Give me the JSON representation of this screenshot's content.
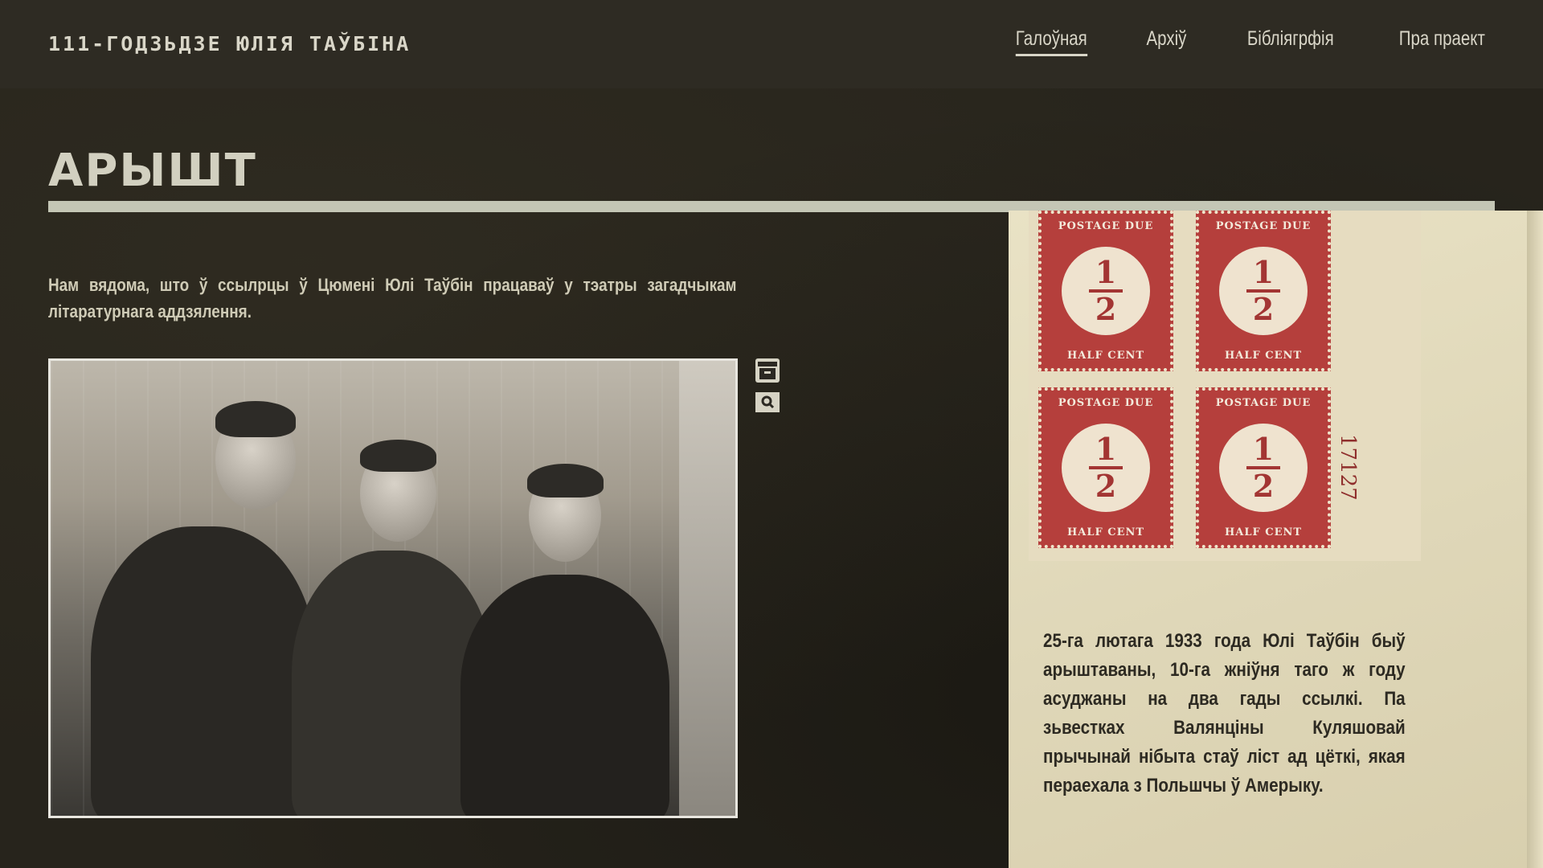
{
  "header": {
    "site_title": "111-ГОДЗЬДЗЕ ЮЛІЯ ТАЎБІНА",
    "nav": [
      {
        "label": "Галоўная",
        "active": true
      },
      {
        "label": "Архіў",
        "active": false
      },
      {
        "label": "Бібліягрфія",
        "active": false
      },
      {
        "label": "Пра праект",
        "active": false
      }
    ]
  },
  "main": {
    "page_title": "АРЫШТ",
    "intro_text": "Нам вядома, што ў ссылрцы ў Цюмені Юлі Таўбін працаваў у тэатры загадчыкам літаратурнага аддзялення.",
    "photo_icons": [
      "archive-icon",
      "search-icon"
    ],
    "panel": {
      "stamps": [
        {
          "top": "POSTAGE DUE",
          "numerator": "1",
          "denominator": "2",
          "bottom": "HALF CENT"
        },
        {
          "top": "POSTAGE DUE",
          "numerator": "1",
          "denominator": "2",
          "bottom": "HALF CENT"
        },
        {
          "top": "POSTAGE DUE",
          "numerator": "1",
          "denominator": "2",
          "bottom": "HALF CENT"
        },
        {
          "top": "POSTAGE DUE",
          "numerator": "1",
          "denominator": "2",
          "bottom": "HALF CENT"
        }
      ],
      "plate_number": "17127",
      "text": "25-га лютага 1933 года Юлі Таўбін быў арыштаваны, 10-га жніўня таго ж году асуджаны на два гады ссылкі. Па зьвестках Валянціны Куляшовай прычынай нібыта стаў ліст ад цёткі, якая пераехала з Польшчы ў Амерыку."
    }
  },
  "colors": {
    "background": "#27241c",
    "header_bg": "#2e2b23",
    "text_light": "#d9d6c8",
    "paper": "#e4dcbd",
    "stamp_red": "#b53f3c",
    "text_dark": "#2d2a22"
  }
}
